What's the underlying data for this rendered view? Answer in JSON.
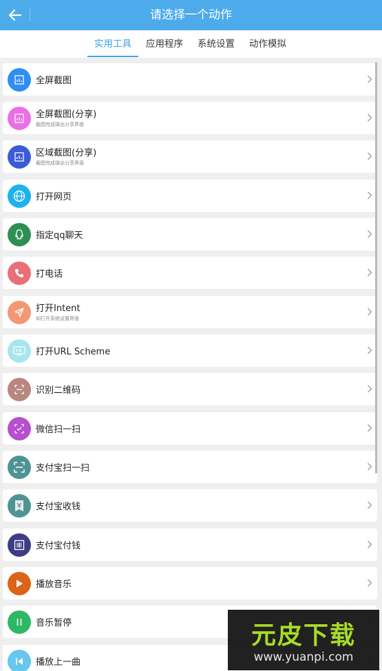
{
  "header": {
    "title": "请选择一个动作",
    "back_icon": "back-arrow-icon"
  },
  "tabs": [
    {
      "label": "实用工具",
      "active": true
    },
    {
      "label": "应用程序",
      "active": false
    },
    {
      "label": "系统设置",
      "active": false
    },
    {
      "label": "动作模拟",
      "active": false
    }
  ],
  "actions": [
    {
      "label": "全屏截图",
      "subtitle": "",
      "icon": "screenshot-icon",
      "color": "#2f8ef4"
    },
    {
      "label": "全屏截图(分享)",
      "subtitle": "截图完成弹出分享界面",
      "icon": "screenshot-share-icon",
      "color": "#ea6fe4"
    },
    {
      "label": "区域截图(分享)",
      "subtitle": "截图完成弹出分享界面",
      "icon": "region-screenshot-icon",
      "color": "#3c5bd9"
    },
    {
      "label": "打开网页",
      "subtitle": "",
      "icon": "globe-icon",
      "color": "#1eb1ee"
    },
    {
      "label": "指定qq聊天",
      "subtitle": "",
      "icon": "qq-icon",
      "color": "#2f8f53"
    },
    {
      "label": "打电话",
      "subtitle": "",
      "icon": "phone-icon",
      "color": "#ea6f77"
    },
    {
      "label": "打开Intent",
      "subtitle": "如打开系统设置界面",
      "icon": "send-icon",
      "color": "#f49774"
    },
    {
      "label": "打开URL Scheme",
      "subtitle": "",
      "icon": "url-icon",
      "color": "#a8e6ee"
    },
    {
      "label": "识别二维码",
      "subtitle": "",
      "icon": "qr-scan-icon",
      "color": "#b8877f"
    },
    {
      "label": "微信扫一扫",
      "subtitle": "",
      "icon": "wechat-scan-icon",
      "color": "#b74fce"
    },
    {
      "label": "支付宝扫一扫",
      "subtitle": "",
      "icon": "alipay-scan-icon",
      "color": "#4f9494"
    },
    {
      "label": "支付宝收钱",
      "subtitle": "",
      "icon": "alipay-receive-icon",
      "color": "#4f9494"
    },
    {
      "label": "支付宝付钱",
      "subtitle": "",
      "icon": "alipay-pay-icon",
      "color": "#3f3c86"
    },
    {
      "label": "播放音乐",
      "subtitle": "",
      "icon": "play-icon",
      "color": "#dc6419"
    },
    {
      "label": "音乐暂停",
      "subtitle": "",
      "icon": "pause-icon",
      "color": "#2eb866"
    },
    {
      "label": "播放上一曲",
      "subtitle": "",
      "icon": "previous-track-icon",
      "color": "#68c6ef"
    }
  ],
  "watermark": {
    "logo": "元皮下载",
    "url": "www.yuanpi.com"
  }
}
